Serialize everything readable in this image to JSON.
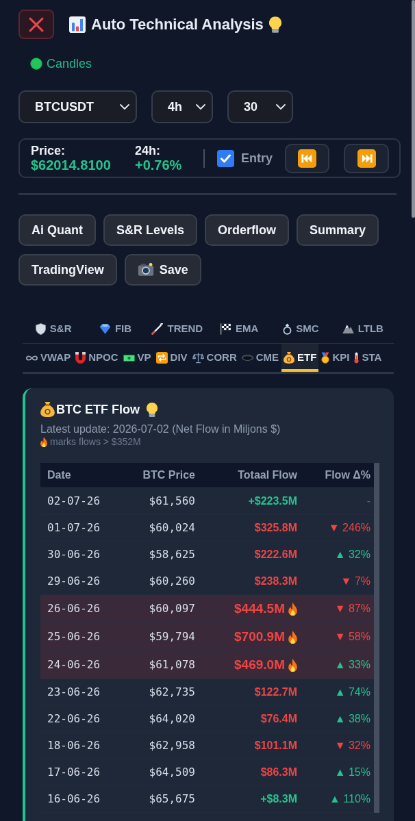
{
  "header": {
    "title": "Auto Technical Analysis"
  },
  "mode": {
    "label": "Candles"
  },
  "selects": [
    {
      "value": "BTCUSDT"
    },
    {
      "value": "4h"
    },
    {
      "value": "30"
    }
  ],
  "price_bar": {
    "price_label": "Price:",
    "price": "$62014.8100",
    "change_label": "24h:",
    "change": "+0.76%",
    "change_up": true,
    "entry": {
      "label": "Entry",
      "checked": true
    }
  },
  "actions": [
    "Ai Quant",
    "S&R Levels",
    "Orderflow",
    "Summary",
    "TradingView",
    "Save"
  ],
  "tab_rows": [
    {
      "kind": "grid",
      "tabs": [
        {
          "label": "S&R",
          "selected": false
        },
        {
          "label": "FIB",
          "selected": false
        },
        {
          "label": "TREND",
          "selected": false
        },
        {
          "label": "EMA",
          "selected": false
        },
        {
          "label": "SMC",
          "selected": false
        },
        {
          "label": "LTLB",
          "selected": false
        }
      ]
    },
    {
      "kind": "strip",
      "tabs": [
        {
          "label": "VWAP",
          "selected": false
        },
        {
          "label": "NPOC",
          "selected": false
        },
        {
          "label": "VP",
          "selected": false
        },
        {
          "label": "DIV",
          "selected": false
        },
        {
          "label": "CORR",
          "selected": false
        },
        {
          "label": "CME",
          "selected": false
        },
        {
          "label": "ETF",
          "selected": true
        },
        {
          "label": "KPI",
          "selected": false
        },
        {
          "label": "STA",
          "selected": false
        }
      ]
    }
  ],
  "etf_card": {
    "title": "BTC ETF Flow",
    "subtitle": "Latest update: 2026-07-02 (Net Flow in Miljons $)",
    "note": "marks flows > $352M",
    "table": {
      "columns": [
        "Date",
        "BTC Price",
        "Totaal Flow",
        "Flow Δ%"
      ],
      "rows": [
        {
          "date": "02-07-26",
          "btc_price": "$61,560",
          "total_flow": "+$223.5M",
          "inflow": true,
          "hot": false,
          "flow_delta": {
            "text": "-",
            "kind": "flat"
          }
        },
        {
          "date": "01-07-26",
          "btc_price": "$60,024",
          "total_flow": "$325.8M",
          "inflow": false,
          "hot": false,
          "flow_delta": {
            "text": "▼ 246%",
            "kind": "down"
          }
        },
        {
          "date": "30-06-26",
          "btc_price": "$58,625",
          "total_flow": "$222.6M",
          "inflow": false,
          "hot": false,
          "flow_delta": {
            "text": "▲ 32%",
            "kind": "up"
          }
        },
        {
          "date": "29-06-26",
          "btc_price": "$60,260",
          "total_flow": "$238.3M",
          "inflow": false,
          "hot": false,
          "flow_delta": {
            "text": "▼ 7%",
            "kind": "down"
          }
        },
        {
          "date": "26-06-26",
          "btc_price": "$60,097",
          "total_flow": "$444.5M",
          "inflow": false,
          "hot": true,
          "flow_delta": {
            "text": "▼ 87%",
            "kind": "down"
          }
        },
        {
          "date": "25-06-26",
          "btc_price": "$59,794",
          "total_flow": "$700.9M",
          "inflow": false,
          "hot": true,
          "flow_delta": {
            "text": "▼ 58%",
            "kind": "down"
          }
        },
        {
          "date": "24-06-26",
          "btc_price": "$61,078",
          "total_flow": "$469.0M",
          "inflow": false,
          "hot": true,
          "flow_delta": {
            "text": "▲ 33%",
            "kind": "up"
          }
        },
        {
          "date": "23-06-26",
          "btc_price": "$62,735",
          "total_flow": "$122.7M",
          "inflow": false,
          "hot": false,
          "flow_delta": {
            "text": "▲ 74%",
            "kind": "up"
          }
        },
        {
          "date": "22-06-26",
          "btc_price": "$64,020",
          "total_flow": "$76.4M",
          "inflow": false,
          "hot": false,
          "flow_delta": {
            "text": "▲ 38%",
            "kind": "up"
          }
        },
        {
          "date": "18-06-26",
          "btc_price": "$62,958",
          "total_flow": "$101.1M",
          "inflow": false,
          "hot": false,
          "flow_delta": {
            "text": "▼ 32%",
            "kind": "down"
          }
        },
        {
          "date": "17-06-26",
          "btc_price": "$64,509",
          "total_flow": "$86.3M",
          "inflow": false,
          "hot": false,
          "flow_delta": {
            "text": "▲ 15%",
            "kind": "up"
          }
        },
        {
          "date": "16-06-26",
          "btc_price": "$65,675",
          "total_flow": "+$8.3M",
          "inflow": true,
          "hot": false,
          "flow_delta": {
            "text": "▲ 110%",
            "kind": "up"
          }
        }
      ]
    }
  }
}
